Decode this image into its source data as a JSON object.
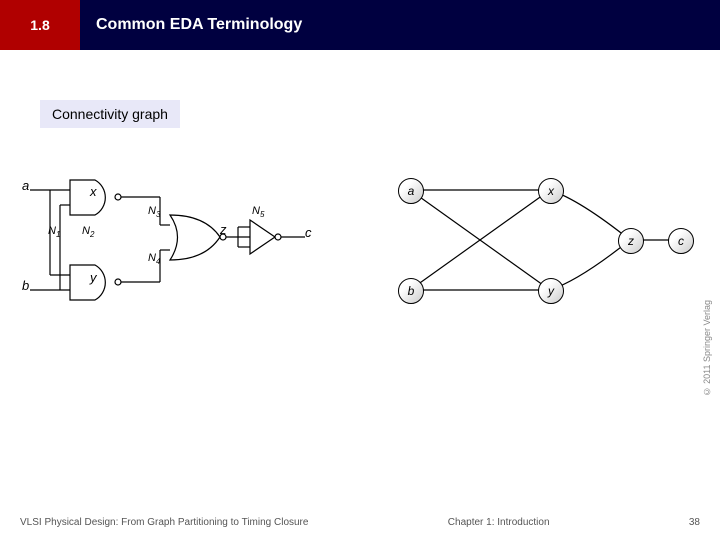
{
  "header": {
    "section_number": "1.8",
    "title": "Common EDA Terminology"
  },
  "subtitle": "Connectivity graph",
  "circuit": {
    "inputs": [
      "a",
      "b"
    ],
    "gate_labels": [
      "x",
      "y"
    ],
    "wire_labels": {
      "n1": "N",
      "n1s": "1",
      "n2": "N",
      "n2s": "2",
      "n3": "N",
      "n3s": "3",
      "n4": "N",
      "n4s": "4",
      "n5": "N",
      "n5s": "5"
    },
    "mid_output": "z",
    "output": "c"
  },
  "graph": {
    "nodes": [
      "a",
      "b",
      "x",
      "y",
      "z",
      "c"
    ]
  },
  "footer": {
    "left": "VLSI Physical Design: From Graph Partitioning to Timing Closure",
    "center": "Chapter 1: Introduction",
    "right": "38"
  },
  "copyright": "© 2011 Springer Verlag"
}
